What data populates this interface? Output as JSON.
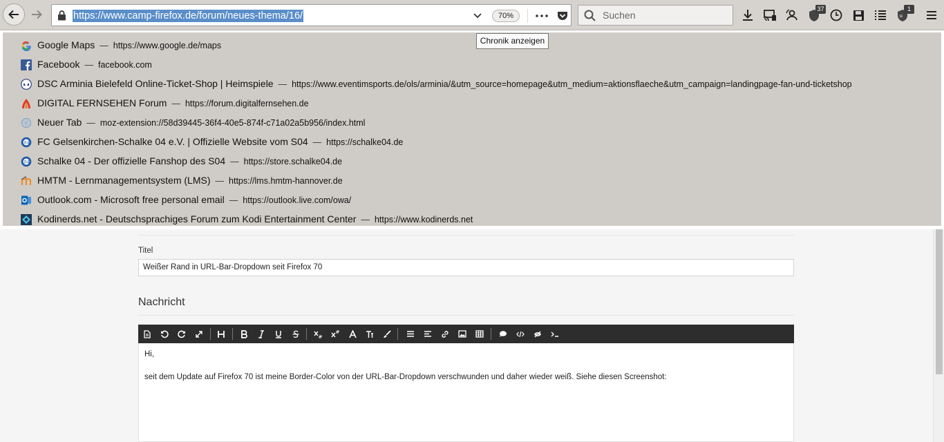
{
  "browser": {
    "url": "https://www.camp-firefox.de/forum/neues-thema/16/",
    "zoom": "70%",
    "search_placeholder": "Suchen",
    "tooltip": "Chronik anzeigen",
    "badges": {
      "shield": "37",
      "ublock": "1"
    }
  },
  "dropdown": {
    "items": [
      {
        "title": "Google Maps",
        "url": "https://www.google.de/maps",
        "icon": "google-icon"
      },
      {
        "title": "Facebook",
        "url": "facebook.com",
        "icon": "facebook-icon"
      },
      {
        "title": "DSC Arminia Bielefeld Online-Ticket-Shop | Heimspiele",
        "url": "https://www.eventimsports.de/ols/arminia/&utm_source=homepage&utm_medium=aktionsflaeche&utm_campaign=landingpage-fan-und-ticketshop",
        "icon": "arminia-icon"
      },
      {
        "title": "DIGITAL FERNSEHEN Forum",
        "url": "https://forum.digitalfernsehen.de",
        "icon": "digital-fernsehen-icon"
      },
      {
        "title": "Neuer Tab",
        "url": "moz-extension://58d39445-36f4-40e5-874f-c71a02a5b956/index.html",
        "icon": "newtab-icon"
      },
      {
        "title": "FC Gelsenkirchen-Schalke 04 e.V. | Offizielle Website vom S04",
        "url": "https://schalke04.de",
        "icon": "schalke-icon"
      },
      {
        "title": "Schalke 04 - Der offizielle Fanshop des S04",
        "url": "https://store.schalke04.de",
        "icon": "schalke-icon"
      },
      {
        "title": "HMTM - Lernmanagementsystem (LMS)",
        "url": "https://lms.hmtm-hannover.de",
        "icon": "moodle-icon"
      },
      {
        "title": "Outlook.com - Microsoft free personal email",
        "url": "https://outlook.live.com/owa/",
        "icon": "outlook-icon"
      },
      {
        "title": "Kodinerds.net - Deutschsprachiges Forum zum Kodi Entertainment Center",
        "url": "https://www.kodinerds.net",
        "icon": "kodi-icon"
      }
    ],
    "separator": "—"
  },
  "page": {
    "title_label": "Titel",
    "title_value": "Weißer Rand in URL-Bar-Dropdown seit Firefox 70",
    "message_heading": "Nachricht",
    "editor_lines": [
      "Hi,",
      "seit dem Update auf Firefox 70 ist meine Border-Color von der URL-Bar-Dropdown verschwunden und daher wieder weiß. Siehe diesen Screenshot:"
    ]
  },
  "colors": {
    "toolbar": "#d6d3ce",
    "dropdown": "#cfccc7",
    "selection": "#5a8ec9",
    "editor_toolbar": "#2d2d2d"
  }
}
